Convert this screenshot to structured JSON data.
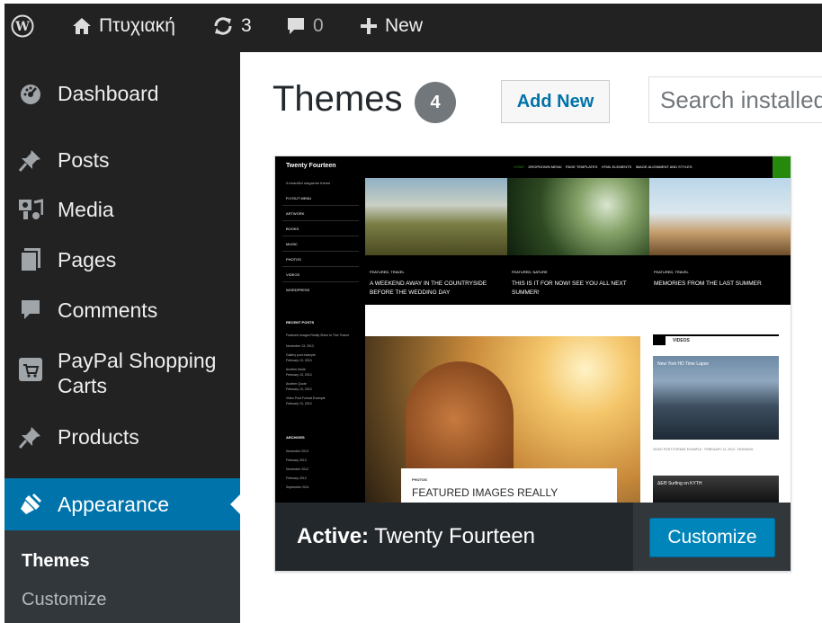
{
  "admin_bar": {
    "site_name": "Πτυχιακή",
    "updates_count": "3",
    "comments_count": "0",
    "new_label": "New"
  },
  "sidebar": {
    "items": [
      {
        "label": "Dashboard",
        "icon": "dashboard-icon"
      },
      {
        "label": "Posts",
        "icon": "pin-icon"
      },
      {
        "label": "Media",
        "icon": "media-icon"
      },
      {
        "label": "Pages",
        "icon": "pages-icon"
      },
      {
        "label": "Comments",
        "icon": "comment-icon"
      },
      {
        "label": "PayPal Shopping\nCarts",
        "icon": "cart-icon"
      },
      {
        "label": "Products",
        "icon": "pin-icon"
      },
      {
        "label": "Appearance",
        "icon": "brush-icon"
      }
    ],
    "submenu": [
      {
        "label": "Themes"
      },
      {
        "label": "Customize"
      }
    ]
  },
  "main": {
    "title": "Themes",
    "theme_count": "4",
    "add_new_label": "Add New",
    "search_placeholder": "Search installed themes..."
  },
  "theme_card": {
    "active_prefix": "Active:",
    "theme_name": "Twenty Fourteen",
    "customize_label": "Customize",
    "screenshot": {
      "site_title": "Twenty Fourteen",
      "tagline": "A beautiful magazine theme",
      "nav": [
        "HOME",
        "DROPDOWN MENU",
        "PAGE TEMPLATES",
        "HTML ELEMENTS",
        "IMAGE ALIGNMENT AND STYLES"
      ],
      "menu": [
        "FLYOUT MENU",
        "ARTWORK",
        "BOOKS",
        "MUSIC",
        "PHOTOS",
        "VIDEOS",
        "WORDPRESS"
      ],
      "featured": [
        {
          "category": "FEATURED, TRAVEL",
          "title": "A WEEKEND AWAY IN THE COUNTRYSIDE BEFORE THE WEDDING DAY"
        },
        {
          "category": "FEATURED, NATURE",
          "title": "THIS IS IT FOR NOW! SEE YOU ALL NEXT SUMMER!"
        },
        {
          "category": "FEATURED, TRAVEL",
          "title": "MEMORIES FROM THE LAST SUMMER"
        }
      ],
      "recent_posts_heading": "RECENT POSTS",
      "recent_posts": [
        "Featured Images Really Shine In This Theme",
        "November 13, 2013",
        "Gallery post example",
        "February 13, 2013",
        "Another Aside",
        "February 13, 2013",
        "Another Quote",
        "February 13, 2013",
        "Video Post Format Example",
        "February 13, 2013"
      ],
      "archives_heading": "ARCHIVES",
      "archives": [
        "November 2013",
        "February 2013",
        "November 2012",
        "February 2012",
        "September 2011"
      ],
      "post_category": "PHOTOS",
      "post_title": "FEATURED IMAGES REALLY",
      "videos_heading": "VIDEOS",
      "video_title": "New York HD Time Lapse",
      "video_caption": "VIDEO POST FORMAT EXAMPLE · FEBRUARY 13, 2013 · DEKNUNG",
      "video2_title": "ΔΕΘ Surfing on KYTH"
    }
  },
  "colors": {
    "admin_bar_bg": "#222222",
    "sidebar_bg": "#222222",
    "active_menu_bg": "#0073aa",
    "submenu_bg": "#32373c",
    "button_primary": "#0085ba",
    "count_badge": "#72777c"
  }
}
